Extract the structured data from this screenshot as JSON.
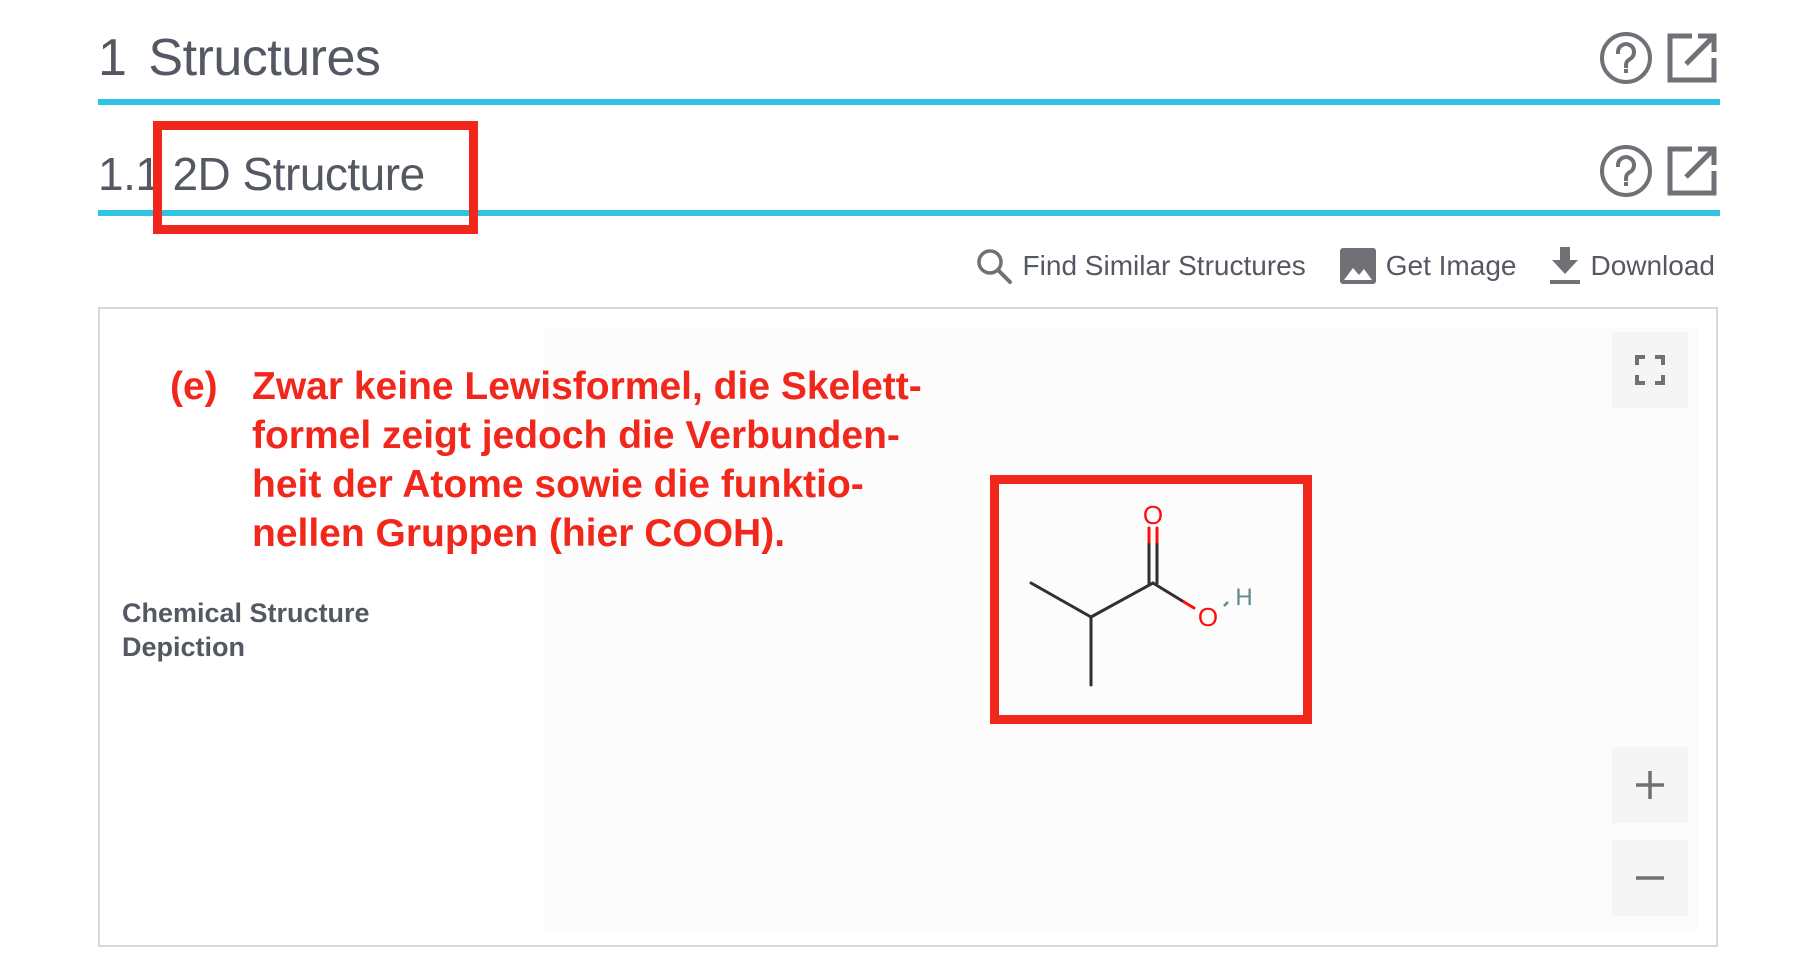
{
  "section": {
    "number": "1",
    "title": "Structures",
    "help_icon": "help-circle-icon",
    "open_icon": "external-link-icon"
  },
  "subsection": {
    "number": "1.1",
    "title": "2D Structure",
    "help_icon": "help-circle-icon",
    "open_icon": "external-link-icon"
  },
  "toolbar": {
    "items": [
      {
        "label": "Find Similar Structures",
        "icon": "search-icon"
      },
      {
        "label": "Get Image",
        "icon": "image-icon"
      },
      {
        "label": "Download",
        "icon": "download-icon"
      }
    ]
  },
  "panel": {
    "label": "Chemical Structure Depiction",
    "label_lines": [
      "Chemical Structure",
      "Depiction"
    ],
    "controls": {
      "fullscreen_icon": "fullscreen-icon",
      "zoom_in": "+",
      "zoom_out": "−"
    },
    "molecule": {
      "atoms": [
        {
          "symbol": "O",
          "color": "#ff0d0d"
        },
        {
          "symbol": "O",
          "color": "#ff0d0d"
        },
        {
          "symbol": "H",
          "color": "#5e8c8c"
        }
      ]
    }
  },
  "annotation": {
    "color": "#f2271c",
    "tag": "(e)",
    "lines": [
      "Zwar keine Lewisformel, die Skelett-",
      "formel zeigt jedoch die Verbunden-",
      "heit der Atome sowie die funktio-",
      "nellen Gruppen (hier COOH)."
    ]
  },
  "colors": {
    "accent_rule": "#2fc4e4",
    "heading_text": "#545862",
    "annotation_red": "#f2271c"
  }
}
